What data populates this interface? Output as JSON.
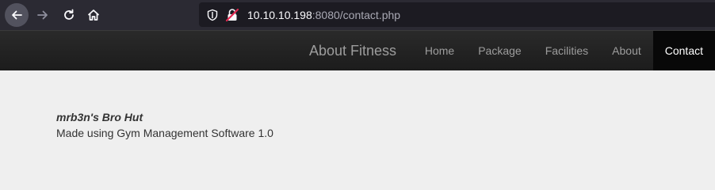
{
  "browser": {
    "url_host": "10.10.10.198",
    "url_rest": ":8080/contact.php",
    "icons": {
      "back": "arrow-left-icon",
      "forward": "arrow-right-icon",
      "reload": "reload-icon",
      "home": "home-icon",
      "tracking": "shield-icon",
      "security": "insecure-lock-icon"
    }
  },
  "navbar": {
    "brand": "About Fitness",
    "links": [
      {
        "label": "Home"
      },
      {
        "label": "Package"
      },
      {
        "label": "Facilities"
      },
      {
        "label": "About"
      },
      {
        "label": "Contact",
        "active": true
      }
    ]
  },
  "content": {
    "company": "mrb3n's Bro Hut",
    "footer_text": "Made using Gym Management Software 1.0"
  },
  "colors": {
    "toolbar_bg": "#2b2a33",
    "urlbar_bg": "#1c1b22",
    "navbar_bg": "#222222",
    "active_link_bg": "#080808",
    "page_bg": "#efefef",
    "insecure_red": "#e22850"
  }
}
